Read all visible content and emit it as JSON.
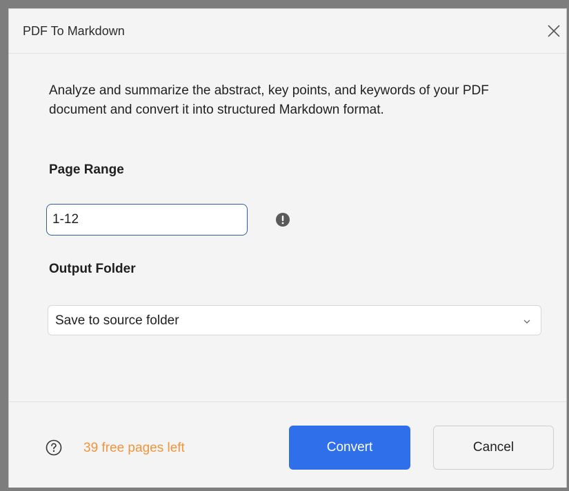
{
  "dialog": {
    "title": "PDF To Markdown",
    "close_icon": "close-icon"
  },
  "body": {
    "description": "Analyze and summarize the abstract, key points, and keywords of your PDF document and convert it into structured Markdown format.",
    "page_range": {
      "label": "Page Range",
      "value": "1-12",
      "info_icon": "exclamation-circle-icon"
    },
    "output_folder": {
      "label": "Output Folder",
      "selected": "Save to source folder",
      "chevron_icon": "chevron-down-icon"
    }
  },
  "footer": {
    "help_icon": "question-circle-icon",
    "free_pages_text": "39 free pages left",
    "convert_label": "Convert",
    "cancel_label": "Cancel"
  },
  "colors": {
    "accent": "#2f6fea",
    "warning_text": "#f0953b",
    "info_icon": "#5a5a5a"
  }
}
